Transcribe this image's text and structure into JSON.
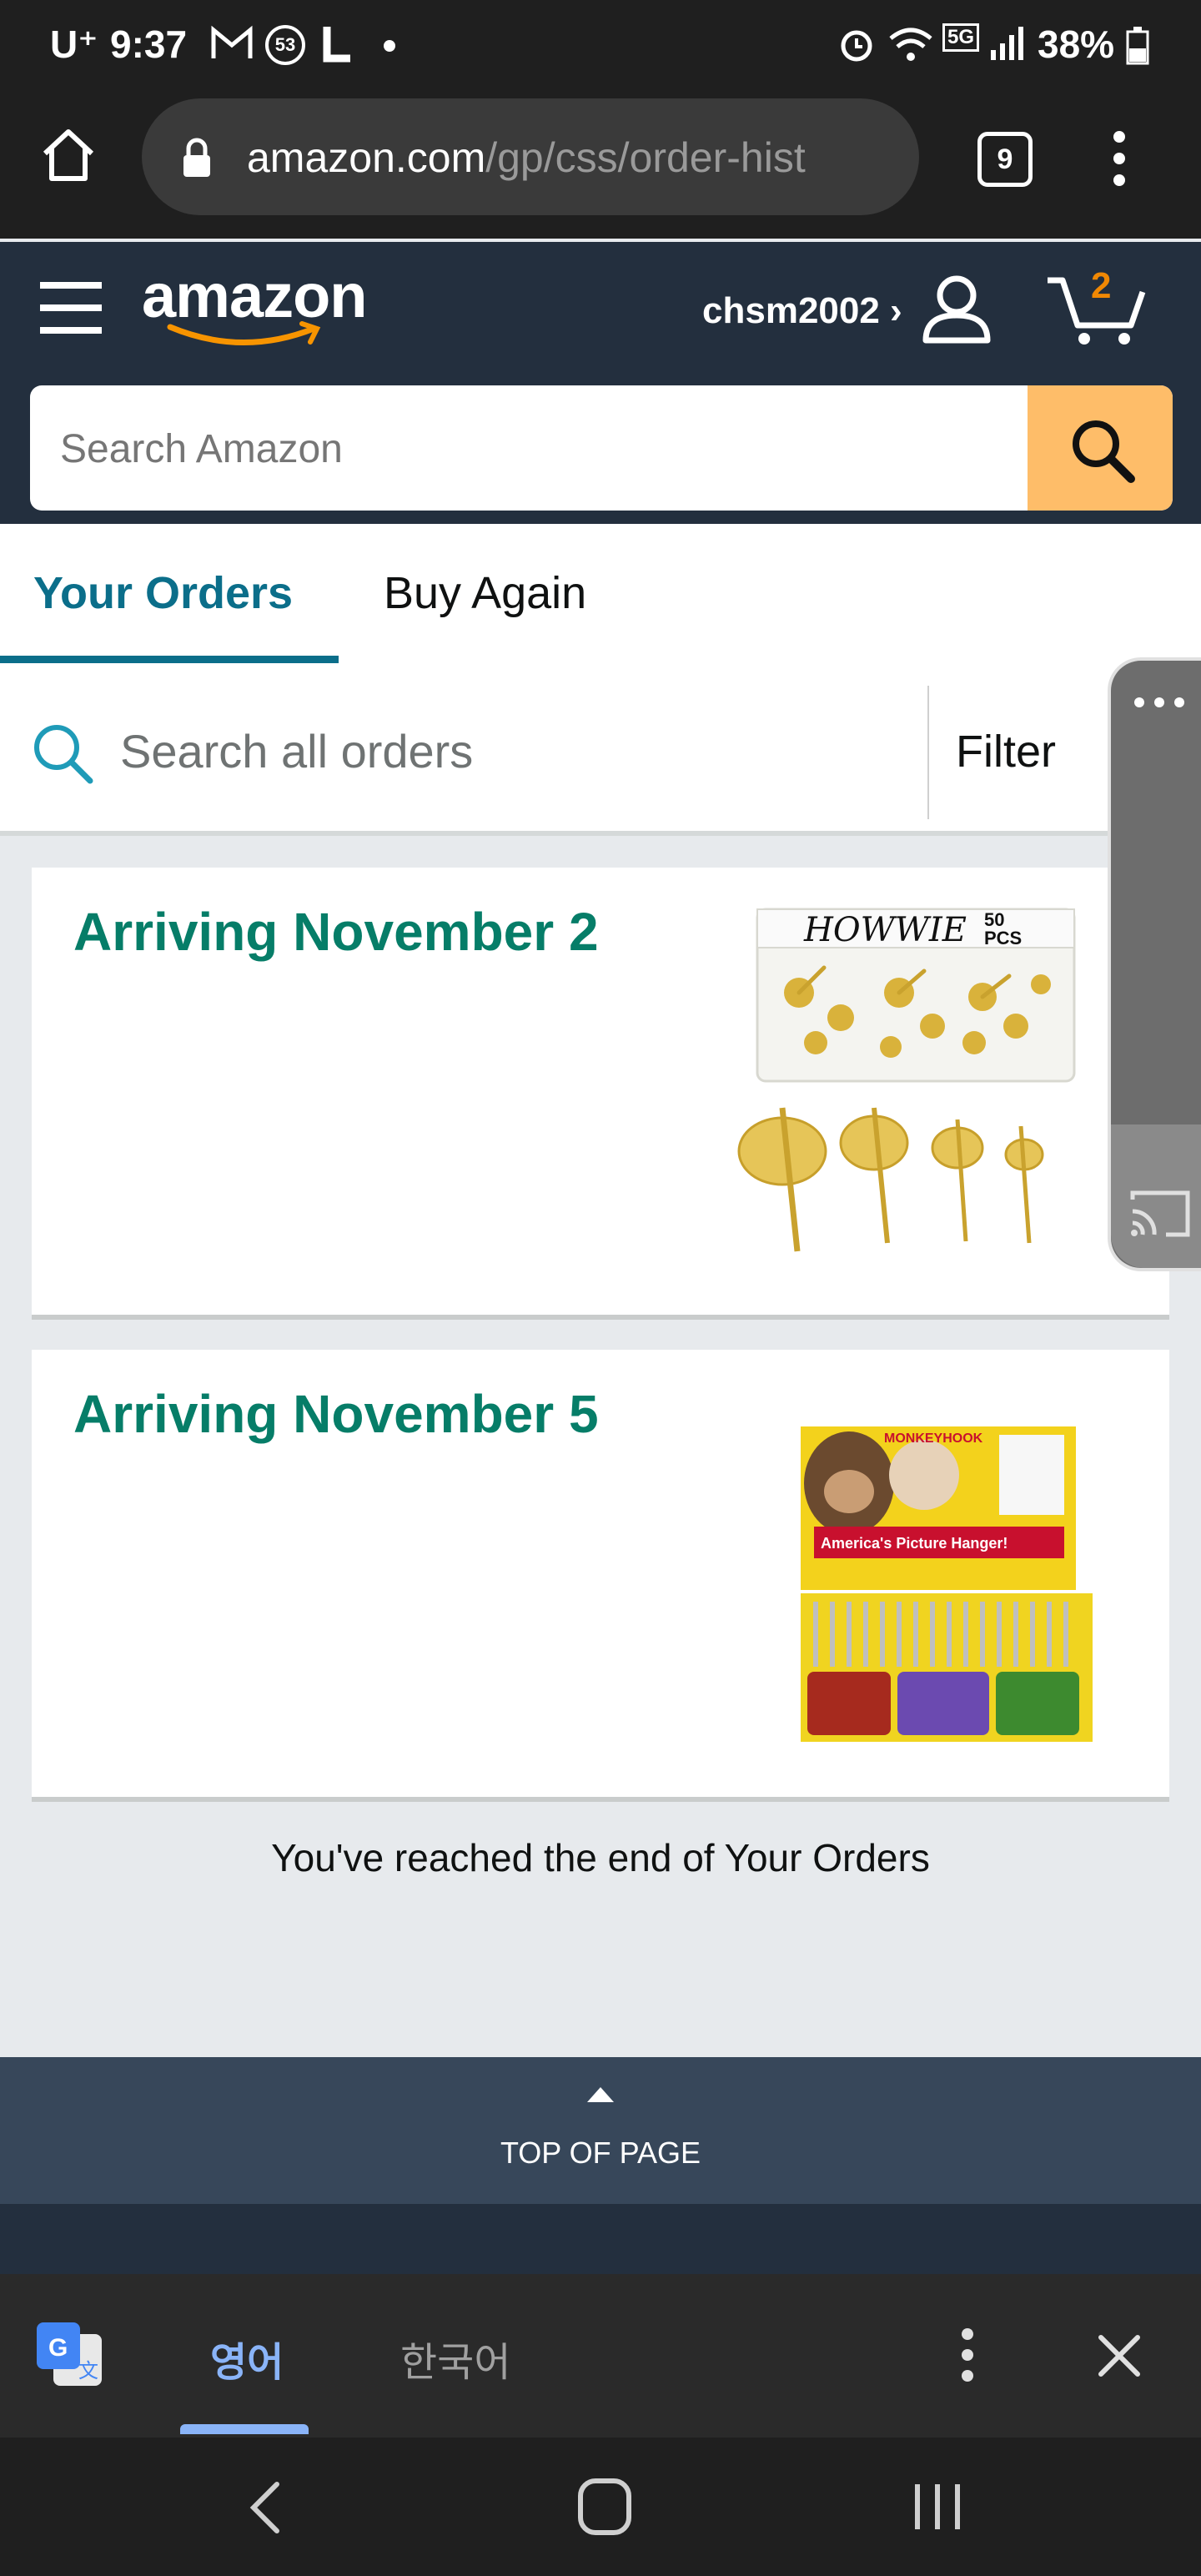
{
  "status_bar": {
    "carrier": "U⁺",
    "time": "9:37",
    "notification_badge": "53",
    "network": "5G",
    "battery": "38%"
  },
  "browser": {
    "url_domain": "amazon.com",
    "url_path": "/gp/css/order-hist",
    "tab_count": "9"
  },
  "header": {
    "logo_text": "amazon",
    "username": "chsm2002 ›",
    "cart_count": "2",
    "search_placeholder": "Search Amazon"
  },
  "tabs": [
    {
      "label": "Your Orders",
      "active": true
    },
    {
      "label": "Buy Again",
      "active": false
    }
  ],
  "orders_search": {
    "placeholder": "Search all orders",
    "filter_label": "Filter"
  },
  "orders": [
    {
      "title": "Arriving November 2",
      "image_brand": "HOWWIE",
      "image_text": "50 PCS"
    },
    {
      "title": "Arriving November 5",
      "image_brand": "MONKEYHOOK",
      "image_text": "America's Picture Hanger!"
    }
  ],
  "end_message": "You've reached the end of Your Orders",
  "top_of_page": "TOP OF PAGE",
  "translate": {
    "source_lang": "영어",
    "target_lang": "한국어"
  },
  "colors": {
    "amazon_navy": "#232f3e",
    "amazon_orange": "#febd69",
    "link_teal": "#0b6e8a",
    "arrival_green": "#067d68"
  }
}
